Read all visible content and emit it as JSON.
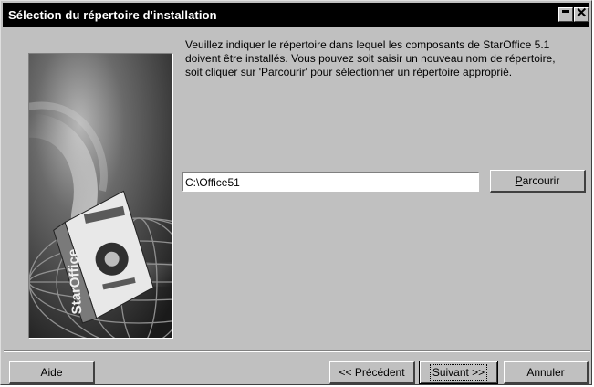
{
  "window": {
    "title": "Sélection du répertoire d'installation"
  },
  "instructions": "Veuillez indiquer le répertoire dans lequel les composants de StarOffice 5.1\ndoivent être installés. Vous pouvez soit saisir un nouveau nom de répertoire,\nsoit cliquer sur 'Parcourir' pour sélectionner un répertoire approprié.",
  "path_input": {
    "value": "C:\\Office51"
  },
  "browse_button": {
    "mnemonic": "P",
    "rest": "arcourir"
  },
  "footer": {
    "help_label": "Aide",
    "prev_label": "<< Précédent",
    "next_label": "Suivant >>",
    "cancel_label": "Annuler"
  },
  "product_box": {
    "brand": "StarOffice"
  }
}
